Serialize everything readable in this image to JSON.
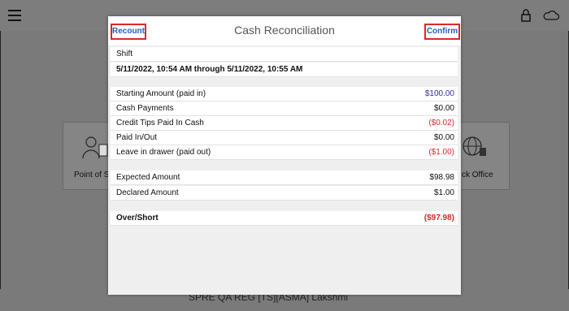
{
  "background": {
    "tiles": {
      "left_label": "Point of S",
      "right_label": "ck Office"
    },
    "bottom_text": "SPRE QA REG [TS][ASMA]  Lakshmi"
  },
  "modal": {
    "title": "Cash Reconciliation",
    "recount_label": "Recount",
    "confirm_label": "Confirm",
    "shift_label": "Shift",
    "shift_range": "5/11/2022, 10:54 AM through 5/11/2022, 10:55 AM",
    "rows": [
      {
        "label": "Starting Amount (paid in)",
        "value": "$100.00"
      },
      {
        "label": "Cash Payments",
        "value": "$0.00"
      },
      {
        "label": "Credit Tips Paid In Cash",
        "value": "($0.02)"
      },
      {
        "label": "Paid In/Out",
        "value": "$0.00"
      },
      {
        "label": "Leave in drawer (paid out)",
        "value": "($1.00)"
      }
    ],
    "expected_label": "Expected Amount",
    "expected_value": "$98.98",
    "declared_label": "Declared Amount",
    "declared_value": "$1.00",
    "over_short_label": "Over/Short",
    "over_short_value": "($97.98)"
  },
  "colors": {
    "accent_blue": "#2a5db5",
    "negative_red": "#e0262a",
    "starting_blue": "#2f2fa2"
  }
}
